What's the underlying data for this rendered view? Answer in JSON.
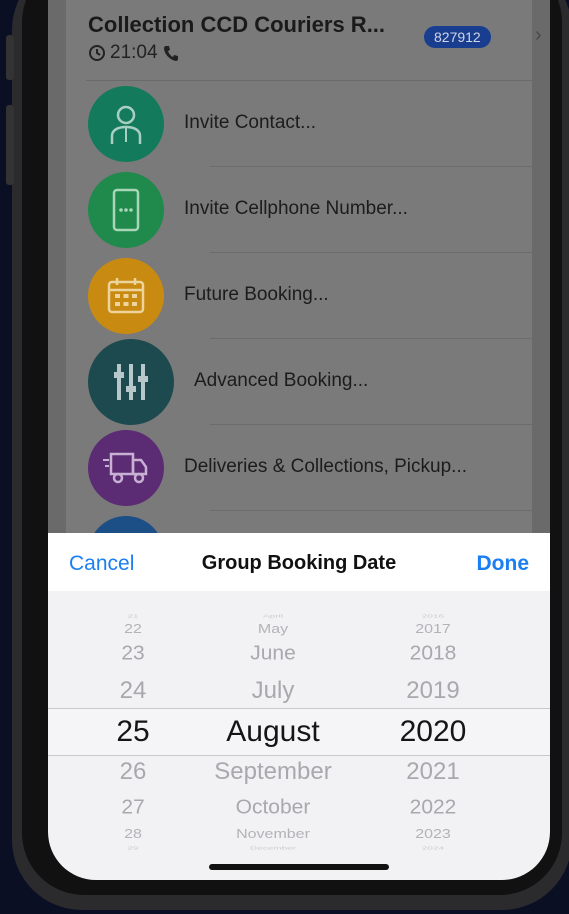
{
  "booking": {
    "title": "Collection CCD Couriers  R...",
    "time": "21:04",
    "code": "827912"
  },
  "menu": [
    {
      "label": "Invite Contact...",
      "icon": "person-icon",
      "color": "#147a5c"
    },
    {
      "label": "Invite Cellphone Number...",
      "icon": "cellphone-icon",
      "color": "#1f8a4c"
    },
    {
      "label": "Future Booking...",
      "icon": "calendar-icon",
      "color": "#c98a12"
    },
    {
      "label": "Advanced Booking...",
      "icon": "sliders-icon",
      "color": "#1d4a4f"
    },
    {
      "label": "Deliveries & Collections, Pickup...",
      "icon": "truck-icon",
      "color": "#5b2b73"
    }
  ],
  "picker": {
    "cancel": "Cancel",
    "title": "Group Booking Date",
    "done": "Done",
    "days": [
      "21",
      "22",
      "23",
      "24",
      "25",
      "26",
      "27",
      "28",
      "29"
    ],
    "months": [
      "April",
      "May",
      "June",
      "July",
      "August",
      "September",
      "October",
      "November",
      "December"
    ],
    "years": [
      "2016",
      "2017",
      "2018",
      "2019",
      "2020",
      "2021",
      "2022",
      "2023",
      "2024"
    ],
    "selected": {
      "day": "25",
      "month": "August",
      "year": "2020"
    }
  },
  "colors": {
    "accent": "#1b7ef2",
    "badge": "#1a3e8f"
  }
}
